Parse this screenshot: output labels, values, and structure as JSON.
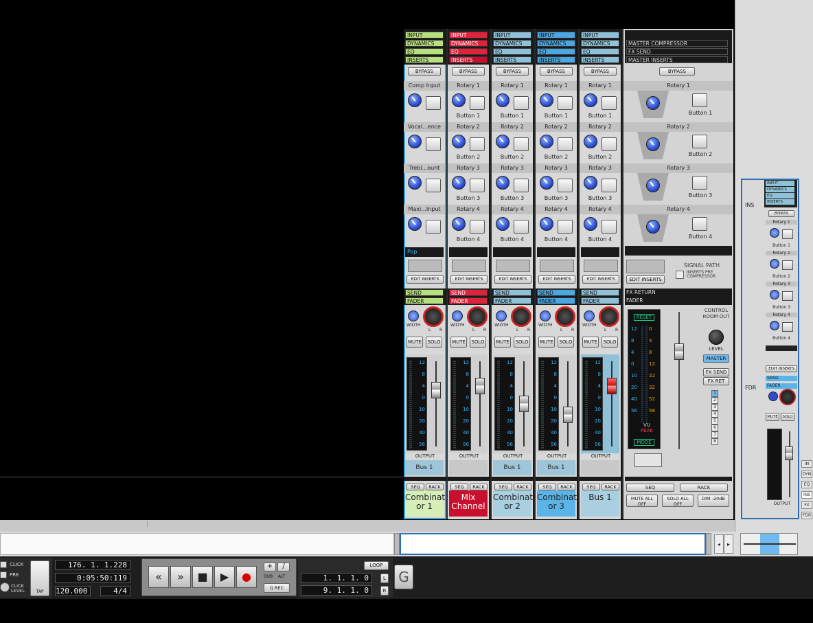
{
  "sections": {
    "input": "INPUT",
    "dynamics": "DYNAMICS",
    "eq": "EQ",
    "inserts": "INSERTS",
    "bypass": "BYPASS",
    "send": "SEND",
    "fader": "FADER",
    "output": "OUTPUT",
    "seq": "SEQ",
    "rack": "RACK",
    "mute": "MUTE",
    "solo": "SOLO",
    "width": "WIDTH",
    "l": "L",
    "r": "R",
    "edit_inserts": "EDIT INSERTS"
  },
  "channels": [
    {
      "name": "Combinat or 1",
      "rotaries": [
        "Comp Input",
        "Vocal...ence",
        "Trebl...ount",
        "Maxi...Input"
      ],
      "buttons": [
        "",
        "",
        "",
        ""
      ],
      "preset": "Pop",
      "bus": "Bus 1",
      "color": "#d6efb8",
      "accent": "#b6e07d"
    },
    {
      "name": "Mix Channel",
      "rotaries": [
        "Rotary 1",
        "Rotary 2",
        "Rotary 3",
        "Rotary 4"
      ],
      "buttons": [
        "Button 1",
        "Button 2",
        "Button 3",
        "Button 4"
      ],
      "preset": "",
      "bus": "",
      "color": "#c8102e",
      "accent": "#e0233b"
    },
    {
      "name": "Combinat or 2",
      "rotaries": [
        "Rotary 1",
        "Rotary 2",
        "Rotary 3",
        "Rotary 4"
      ],
      "buttons": [
        "Button 1",
        "Button 2",
        "Button 3",
        "Button 4"
      ],
      "preset": "",
      "bus": "Bus 1",
      "color": "#a9cfe0",
      "accent": "#8fc1d8"
    },
    {
      "name": "Combinat or 3",
      "rotaries": [
        "Rotary 1",
        "Rotary 2",
        "Rotary 3",
        "Rotary 4"
      ],
      "buttons": [
        "Button 1",
        "Button 2",
        "Button 3",
        "Button 4"
      ],
      "preset": "",
      "bus": "Bus 1",
      "color": "#5ab4e8",
      "accent": "#4aa7e2"
    },
    {
      "name": "Bus 1",
      "rotaries": [
        "Rotary 1",
        "Rotary 2",
        "Rotary 3",
        "Rotary 4"
      ],
      "buttons": [
        "Button 1",
        "Button 2",
        "Button 3",
        "Button 4"
      ],
      "preset": "",
      "bus": "",
      "color": "#a9cfe0",
      "accent": "#8fc1d8"
    }
  ],
  "meter_scale": [
    "12",
    "8",
    "4",
    "0",
    "10",
    "20",
    "40",
    "56"
  ],
  "master": {
    "compressor": "MASTER COMPRESSOR",
    "fx_send": "FX SEND",
    "inserts": "MASTER INSERTS",
    "bypass": "BYPASS",
    "rotaries": [
      "Rotary 1",
      "Rotary 2",
      "Rotary 3",
      "Rotary 4"
    ],
    "buttons": [
      "Button 1",
      "Button 2",
      "Button 3",
      "Button 4"
    ],
    "edit_inserts": "EDIT INSERTS",
    "signal_path": "SIGNAL PATH",
    "inserts_pre": "INSERTS PRE COMPRESSOR",
    "fx_return": "FX RETURN",
    "fader": "FADER",
    "reset": "RESET",
    "vu_left": [
      "12",
      "8",
      "4",
      "0",
      "10",
      "20",
      "40",
      "56"
    ],
    "vu_right": [
      "0",
      "4",
      "8",
      "12",
      "22",
      "32",
      "52",
      "58"
    ],
    "vu": "VU",
    "peak": "PEAK",
    "mode": "MODE",
    "control_room": "CONTROL ROOM OUT",
    "level": "LEVEL",
    "master_btn": "MASTER",
    "fx_send_btn": "FX SEND",
    "fx_ret_btn": "FX RET",
    "numbers": [
      "1",
      "2",
      "3",
      "4",
      "5",
      "6",
      "7",
      "8"
    ],
    "seq": "SEQ",
    "rack": "RACK",
    "mute_all": "MUTE ALL OFF",
    "solo_all": "SOLO ALL OFF",
    "dim": "DIM -20dB"
  },
  "right": {
    "ins": "INS",
    "fdr": "FDR",
    "tabs": [
      "IN",
      "DYN",
      "EQ",
      "INS",
      "FX",
      "FDR"
    ],
    "bypass": "BYPASS",
    "rotaries": [
      "Rotary 1",
      "Rotary 2",
      "Rotary 3",
      "Rotary 4"
    ],
    "buttons": [
      "Button 1",
      "Button 2",
      "Button 3",
      "Button 4"
    ],
    "edit_inserts": "EDIT INSERTS",
    "send": "SEND",
    "fader": "FADER",
    "output": "OUTPUT",
    "mute": "MUTE",
    "solo": "SOLO",
    "width": "WIDTH"
  },
  "transport": {
    "click": "CLICK",
    "pre": "PRE",
    "click_level": "CLICK LEVEL",
    "tap": "TAP",
    "position": "176. 1. 1.228",
    "time": "0:05:50:119",
    "tempo": "120.000",
    "signature": "4/4",
    "dub": "DUB",
    "alt": "ALT",
    "qrec": "Q REC",
    "loop": "LOOP",
    "left_loc": "1. 1. 1. 0",
    "right_loc": "9. 1. 1. 0",
    "l": "L",
    "r": "R"
  }
}
